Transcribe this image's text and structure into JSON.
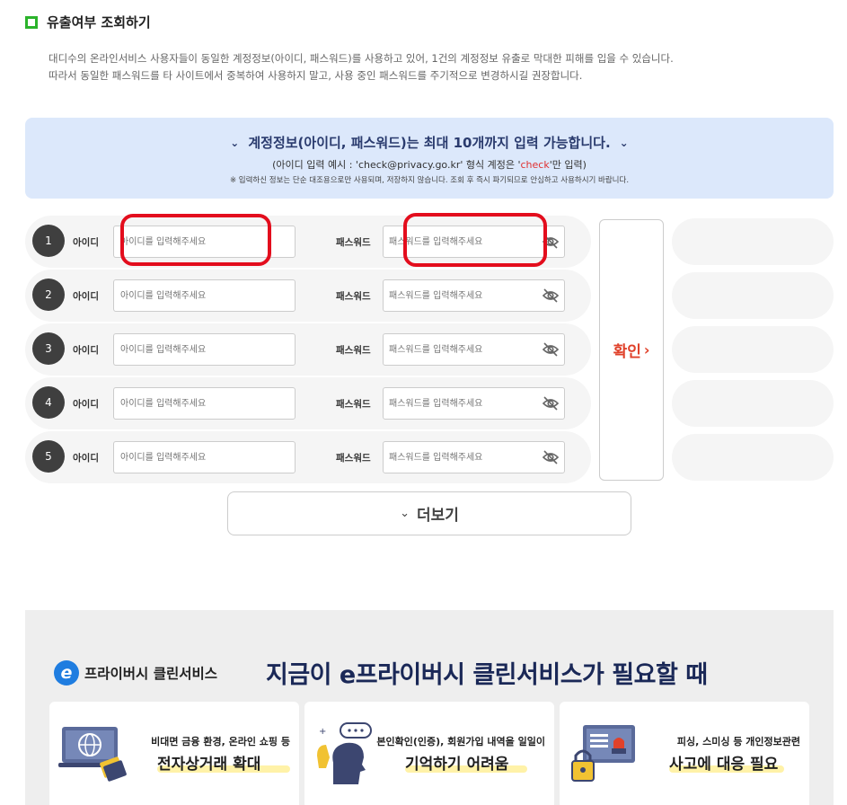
{
  "section": {
    "title": "유출여부 조회하기"
  },
  "description": [
    "대디수의 온라인서비스 사용자들이 동일한 계정정보(아이디, 패스워드)를 사용하고 있어, 1건의 계정정보 유출로 막대한 피해를 입을 수 있습니다.",
    "따라서 동일한 패스워드를 타 사이트에서 중복하여 사용하지 말고, 사용 중인 패스워드를 주기적으로 변경하시길 권장합니다."
  ],
  "info": {
    "headline": "계정정보(아이디, 패스워드)는 최대 10개까지 입력 가능합니다.",
    "example_prefix": "(아이디 입력 예시 : 'check@privacy.go.kr' 형식 계정은 '",
    "example_highlight": "check",
    "example_suffix": "'만 입력)",
    "note": "※ 입력하신 정보는 단순 대조용으로만 사용되며, 저장하지 않습니다. 조회 후 즉시 파기되므로 안심하고 사용하시기 바랍니다."
  },
  "form": {
    "id_label": "아이디",
    "pw_label": "패스워드",
    "id_placeholder": "아이디를 입력해주세요",
    "pw_placeholder": "패스워드를 입력해주세요",
    "rows": [
      {
        "num": "1",
        "id_value": "",
        "pw_value": ""
      },
      {
        "num": "2",
        "id_value": "",
        "pw_value": ""
      },
      {
        "num": "3",
        "id_value": "",
        "pw_value": ""
      },
      {
        "num": "4",
        "id_value": "",
        "pw_value": ""
      },
      {
        "num": "5",
        "id_value": "",
        "pw_value": ""
      }
    ],
    "confirm_label": "확인",
    "more_label": "더보기"
  },
  "promo": {
    "logo_letter": "e",
    "brand": "프라이버시 클린서비스",
    "slogan": "지금이 e프라이버시 클린서비스가 필요할 때",
    "cards": [
      {
        "line1": "비대면 금융 환경, 온라인 쇼핑 등",
        "line2": "전자상거래 확대",
        "icon": "globe-laptop-icon"
      },
      {
        "line1": "본인확인(인증), 회원가입 내역을 일일이",
        "line2": "기억하기 어려움",
        "icon": "thinking-person-icon"
      },
      {
        "line1": "피싱, 스미싱 등 개인정보관련",
        "line2": "사고에 대응 필요",
        "icon": "padlock-screen-icon"
      }
    ]
  },
  "colors": {
    "accent_green": "#2bb32b",
    "info_bg": "#dce8fb",
    "confirm_red": "#e0412a",
    "highlight_red": "#e30d1d",
    "navy": "#1a2857"
  }
}
